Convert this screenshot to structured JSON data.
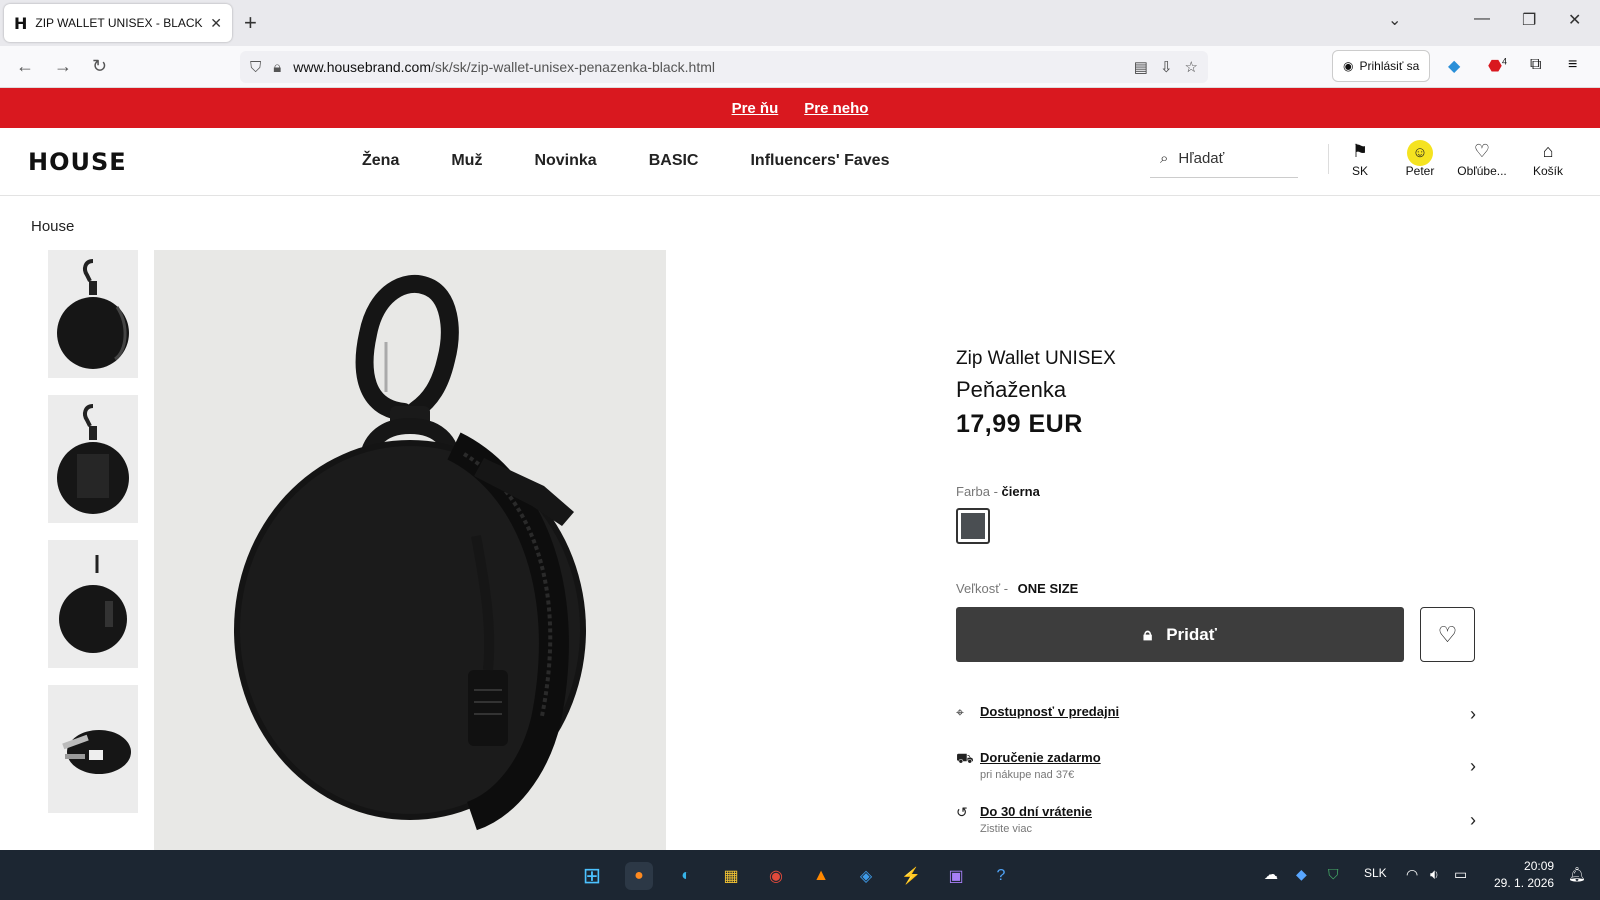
{
  "browser": {
    "tab_title": "ZIP WALLET UNISEX - BLACK",
    "tab_favicon": "H",
    "url_domain": "www.housebrand.com",
    "url_path": "/sk/sk/zip-wallet-unisex-penazenka-black.html",
    "signin_label": "Prihlásiť sa",
    "ext_badge": "4"
  },
  "promo": {
    "link_women": "Pre ňu",
    "link_men": "Pre neho"
  },
  "header": {
    "logo": "HOUSE",
    "nav": [
      "Žena",
      "Muž",
      "Novinka",
      "BASIC",
      "Influencers' Faves"
    ],
    "search_placeholder": "Hľadať",
    "lang_label": "SK",
    "user_label": "Peter",
    "favorites_label": "Obľúbe...",
    "cart_label": "Košík"
  },
  "breadcrumb": "House",
  "product": {
    "name": "Zip Wallet UNISEX",
    "subtitle": "Peňaženka",
    "price": "17,99 EUR",
    "color_label": "Farba -",
    "color_value": "čierna",
    "swatch_color": "#4a4e52",
    "size_label": "Veľkosť -",
    "size_value": "ONE SIZE",
    "add_button": "Pridať",
    "info": [
      {
        "title": "Dostupnosť v predajni",
        "sub": ""
      },
      {
        "title": "Doručenie zadarmo",
        "sub": "pri nákupe nad 37€"
      },
      {
        "title": "Do 30 dní vrátenie",
        "sub": "Zistite viac"
      }
    ]
  },
  "taskbar": {
    "lang": "SLK",
    "time": "20:09",
    "date": "29. 1. 2026"
  },
  "colors": {
    "promo_red": "#d9181f",
    "button_dark": "#3d3d3d",
    "taskbar_bg": "#1c2632"
  }
}
